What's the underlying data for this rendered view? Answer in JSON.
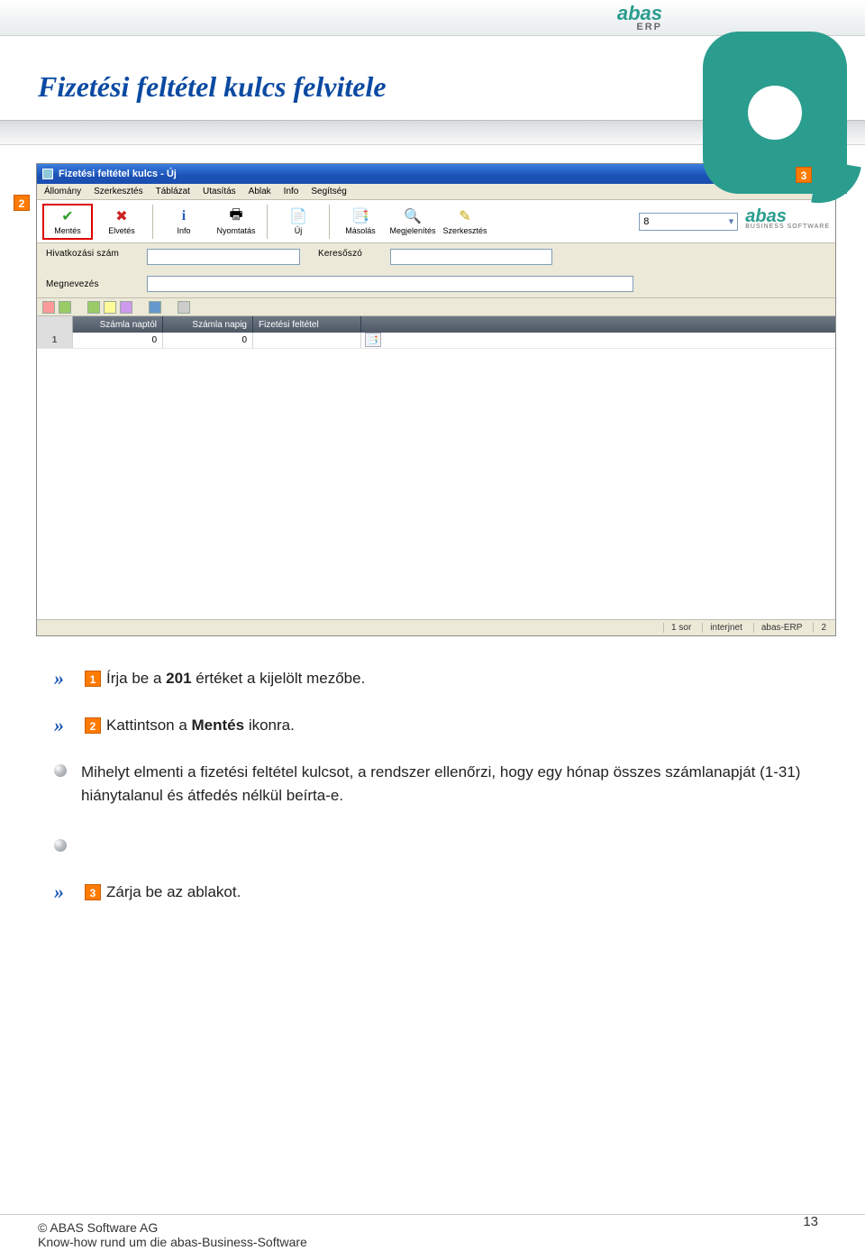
{
  "header": {
    "logo_text": "abas",
    "logo_sub": "ERP"
  },
  "page_title": "Fizetési feltétel kulcs felvitele",
  "appwin": {
    "title": "Fizetési feltétel kulcs - Új",
    "menus": [
      "Állomány",
      "Szerkesztés",
      "Táblázat",
      "Utasítás",
      "Ablak",
      "Info",
      "Segítség"
    ],
    "toolbar": [
      {
        "name": "mentes",
        "label": "Mentés",
        "icon": "✔",
        "color": "#2e9e2e"
      },
      {
        "name": "elvetes",
        "label": "Elvetés",
        "icon": "✖",
        "color": "#cc2222"
      },
      {
        "name": "info",
        "label": "Info",
        "icon": "i",
        "color": "#2a5cc0"
      },
      {
        "name": "nyomtatas",
        "label": "Nyomtatás",
        "icon": "🖶",
        "color": "#555"
      },
      {
        "name": "uj",
        "label": "Új",
        "icon": "📄",
        "color": "#555"
      },
      {
        "name": "masolas",
        "label": "Másolás",
        "icon": "📑",
        "color": "#555"
      },
      {
        "name": "megjelenites",
        "label": "Megjelenítés",
        "icon": "🔍",
        "color": "#555"
      },
      {
        "name": "szerkesztes",
        "label": "Szerkesztés",
        "icon": "✎",
        "color": "#c7a500"
      }
    ],
    "combo_value": "8",
    "brand2": "abas",
    "brand2_sub": "BUSINESS SOFTWARE",
    "form": {
      "ref_label": "Hivatkozási szám",
      "search_label": "Keresőszó",
      "name_label": "Megnevezés"
    },
    "grid": {
      "headers": [
        "",
        "Számla naptól",
        "Számla napig",
        "Fizetési feltétel"
      ],
      "row": {
        "idx": "1",
        "c1": "0",
        "c2": "0",
        "c3": ""
      }
    },
    "status": {
      "rows": "1 sor",
      "net": "interjnet",
      "app": "abas-ERP",
      "v": "2"
    }
  },
  "steps": {
    "s1": {
      "pre": "Írja be a ",
      "bold": "201",
      "post": " értéket a kijelölt mezőbe."
    },
    "s2": {
      "pre": "Kattintson a ",
      "bold": "Mentés",
      "post": " ikonra."
    },
    "info": "Mihelyt elmenti a fizetési feltétel kulcsot, a rendszer ellenőrzi, hogy egy hónap összes számlanapját (1-31) hiánytalanul és átfedés nélkül beírta-e.",
    "s3": "Zárja be az ablakot."
  },
  "badges": {
    "b1": "1",
    "b2": "2",
    "b3": "3"
  },
  "footer": {
    "line1": "© ABAS Software AG",
    "line2": "Know-how rund um die abas-Business-Software",
    "page": "13"
  }
}
